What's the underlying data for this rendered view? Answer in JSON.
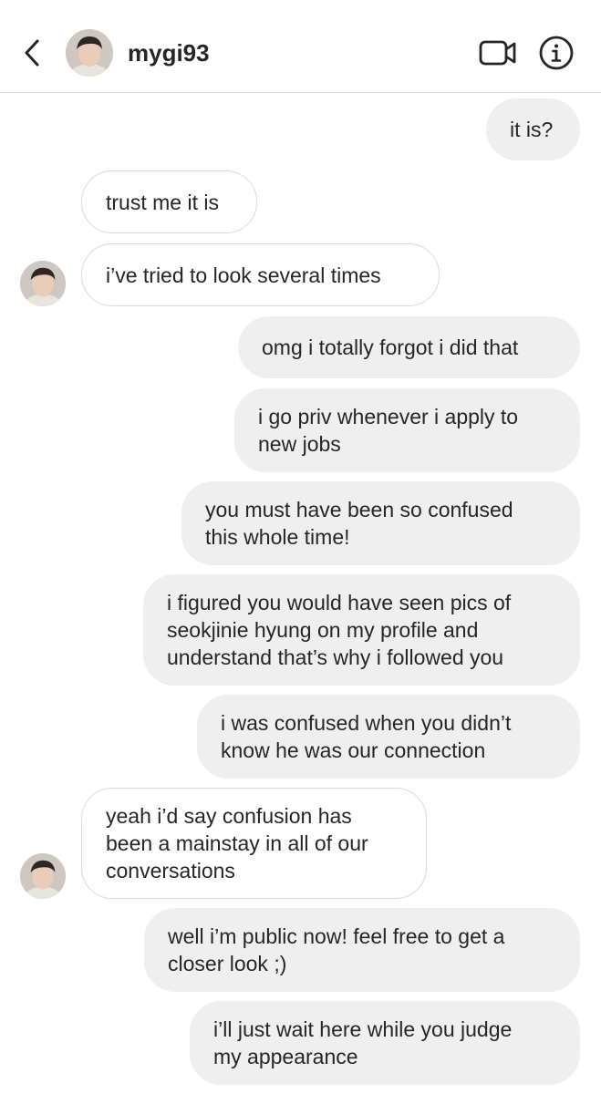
{
  "header": {
    "username": "mygi93",
    "back_icon": "chevron-left-icon",
    "video_icon": "video-camera-icon",
    "info_icon": "info-icon"
  },
  "colors": {
    "sent_bubble": "#efefef",
    "received_border": "#dbdbdb",
    "text": "#262626"
  },
  "messages": [
    {
      "from": "me",
      "text": "it is?"
    },
    {
      "from": "them",
      "text": "trust me it is"
    },
    {
      "from": "them",
      "text": "i’ve tried to look several times"
    },
    {
      "from": "me",
      "text": "omg i totally forgot i did that"
    },
    {
      "from": "me",
      "text": "i go priv whenever i apply to\nnew jobs"
    },
    {
      "from": "me",
      "text": "you must have been so confused\nthis whole time!"
    },
    {
      "from": "me",
      "text": "i figured you would have seen pics of\nseokjinie hyung on my profile and\nunderstand that’s why i followed you"
    },
    {
      "from": "me",
      "text": "i was confused when you didn’t\nknow he was our connection"
    },
    {
      "from": "them",
      "text": "yeah i’d say confusion has\nbeen a mainstay in all of our\nconversations"
    },
    {
      "from": "me",
      "text": "well i’m public now! feel free to get a\ncloser look ;)"
    },
    {
      "from": "me",
      "text": "i’ll just wait here while you judge\nmy appearance"
    }
  ]
}
